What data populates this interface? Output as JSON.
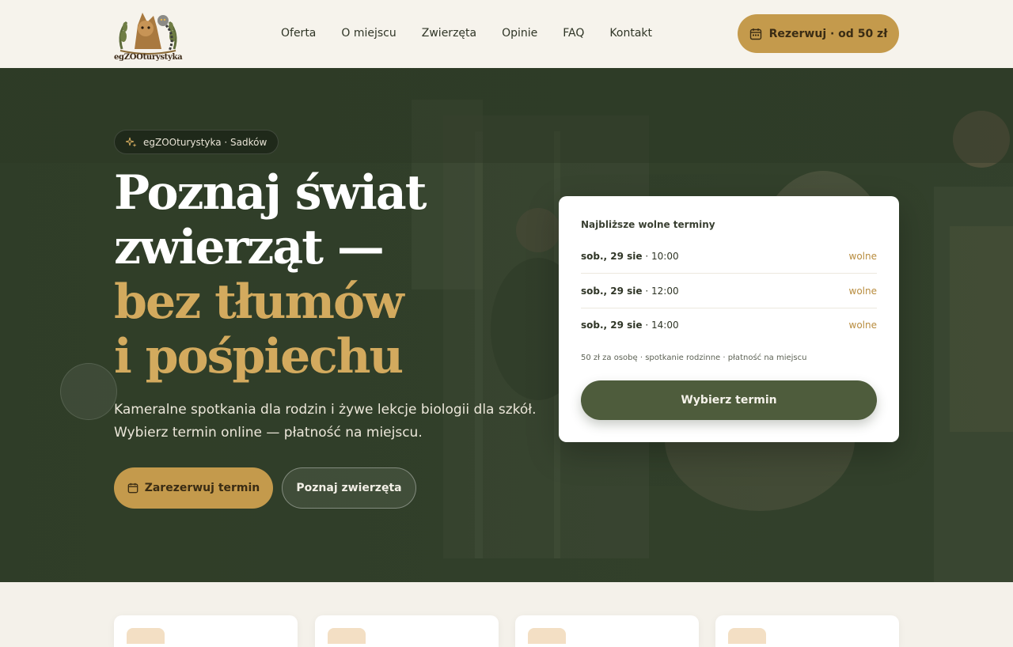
{
  "brand": {
    "logo_text": "egZOOturystyka"
  },
  "nav": {
    "items": [
      "Oferta",
      "O miejscu",
      "Zwierzęta",
      "Opinie",
      "FAQ",
      "Kontakt"
    ]
  },
  "header_cta": {
    "label": "Rezerwuj · od 50 zł",
    "icon": "calendar-icon"
  },
  "hero": {
    "badge": "egZOOturystyka · Sadków",
    "title_line1": "Poznaj świat",
    "title_line2": "zwierząt —",
    "title_line3": "bez tłumów",
    "title_line4": "i pośpiechu",
    "lead_line1": "Kameralne spotkania dla rodzin i żywe lekcje biologii dla szkół.",
    "lead_line2": "Wybierz termin online — płatność na miejscu.",
    "primary_button": "Zarezerwuj termin",
    "secondary_button": "Poznaj zwierzęta"
  },
  "booking": {
    "title": "Najbliższe wolne terminy",
    "slots": [
      {
        "day": "sob., 29 sie",
        "time": "· 10:00",
        "status": "wolne"
      },
      {
        "day": "sob., 29 sie",
        "time": "· 12:00",
        "status": "wolne"
      },
      {
        "day": "sob., 29 sie",
        "time": "· 14:00",
        "status": "wolne"
      }
    ],
    "note": "50 zł za osobę · spotkanie rodzinne · płatność na miejscu",
    "button": "Wybierz termin"
  },
  "colors": {
    "accent_gold": "#c49a4c",
    "forest_green": "#4e5c3c",
    "title_gold": "#d3aa5e"
  }
}
